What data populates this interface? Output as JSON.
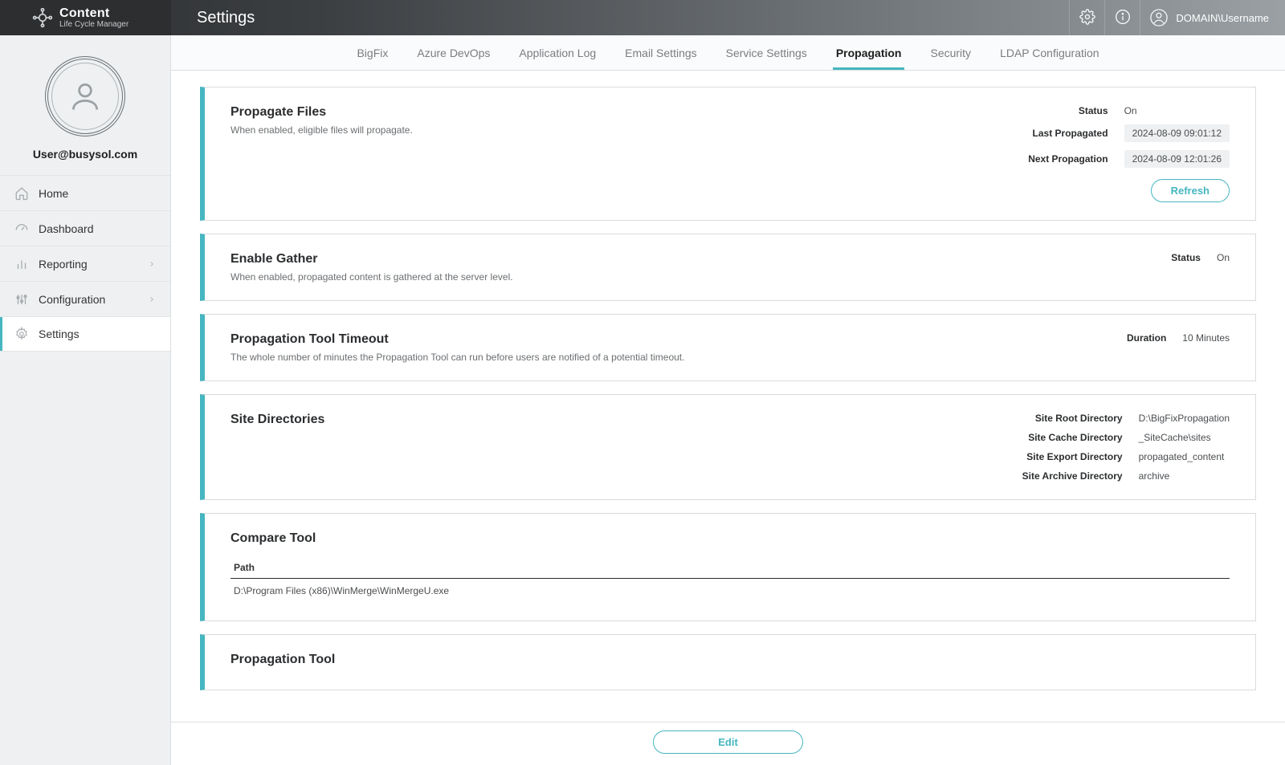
{
  "brand": {
    "title": "Content",
    "subtitle": "Life Cycle Manager"
  },
  "page_title": "Settings",
  "header_user": "DOMAIN\\Username",
  "profile": {
    "email": "User@busysol.com"
  },
  "nav": [
    {
      "label": "Home",
      "icon": "home-icon",
      "expandable": false,
      "active": false
    },
    {
      "label": "Dashboard",
      "icon": "gauge-icon",
      "expandable": false,
      "active": false
    },
    {
      "label": "Reporting",
      "icon": "chart-icon",
      "expandable": true,
      "active": false
    },
    {
      "label": "Configuration",
      "icon": "sliders-icon",
      "expandable": true,
      "active": false
    },
    {
      "label": "Settings",
      "icon": "gear-icon",
      "expandable": false,
      "active": true
    }
  ],
  "tabs": [
    {
      "label": "BigFix",
      "active": false
    },
    {
      "label": "Azure DevOps",
      "active": false
    },
    {
      "label": "Application Log",
      "active": false
    },
    {
      "label": "Email Settings",
      "active": false
    },
    {
      "label": "Service Settings",
      "active": false
    },
    {
      "label": "Propagation",
      "active": true
    },
    {
      "label": "Security",
      "active": false
    },
    {
      "label": "LDAP Configuration",
      "active": false
    }
  ],
  "cards": {
    "propagate_files": {
      "title": "Propagate Files",
      "desc": "When enabled, eligible files will propagate.",
      "status_label": "Status",
      "status_value": "On",
      "last_label": "Last Propagated",
      "last_value": "2024-08-09 09:01:12",
      "next_label": "Next Propagation",
      "next_value": "2024-08-09 12:01:26",
      "refresh": "Refresh"
    },
    "enable_gather": {
      "title": "Enable Gather",
      "desc": "When enabled, propagated content is gathered at the server level.",
      "status_label": "Status",
      "status_value": "On"
    },
    "timeout": {
      "title": "Propagation Tool Timeout",
      "desc": "The whole number of minutes the Propagation Tool can run before users are notified of a potential timeout.",
      "duration_label": "Duration",
      "duration_value": "10 Minutes"
    },
    "site_dirs": {
      "title": "Site Directories",
      "rows": [
        {
          "k": "Site Root Directory",
          "v": "D:\\BigFixPropagation"
        },
        {
          "k": "Site Cache Directory",
          "v": "_SiteCache\\sites"
        },
        {
          "k": "Site Export Directory",
          "v": "propagated_content"
        },
        {
          "k": "Site Archive Directory",
          "v": "archive"
        }
      ]
    },
    "compare_tool": {
      "title": "Compare Tool",
      "col_header": "Path",
      "path": "D:\\Program Files (x86)\\WinMerge\\WinMergeU.exe"
    },
    "prop_tool": {
      "title": "Propagation Tool"
    }
  },
  "footer": {
    "edit": "Edit"
  }
}
